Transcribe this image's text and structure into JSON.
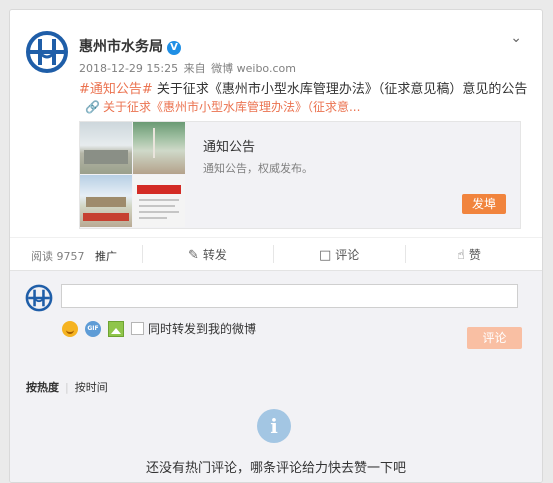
{
  "post": {
    "username": "惠州市水务局",
    "verified_badge": "V",
    "timestamp": "2018-12-29 15:25",
    "source_prefix": "来自",
    "source": "微博 weibo.com",
    "hashtag": "#通知公告#",
    "text": " 关于征求《惠州市小型水库管理办法》（征求意见稿）意见的公告",
    "link_text": "关于征求《惠州市小型水库管理办法》（征求意...",
    "preview": {
      "title": "通知公告",
      "description": "通知公告，权威发布。",
      "publish_label": "发埠"
    }
  },
  "actions": {
    "read_label": "阅读",
    "read_count": "9757",
    "promote_label": "推广",
    "repost_label": "转发",
    "comment_label": "评论",
    "like_label": "赞"
  },
  "comment_box": {
    "input_value": "",
    "repost_checkbox_label": "同时转发到我的微博",
    "submit_label": "评论"
  },
  "sort": {
    "by_hot": "按热度",
    "by_time": "按时间"
  },
  "empty_state": {
    "icon_text": "i",
    "message": "还没有热门评论，哪条评论给力快去赞一下吧"
  },
  "colors": {
    "accent": "#eb7350",
    "publish_button": "#f1843d",
    "comment_button_disabled": "#f9bfa3",
    "logo_blue": "#1f5ea8",
    "verified_blue": "#1f8fe5"
  }
}
